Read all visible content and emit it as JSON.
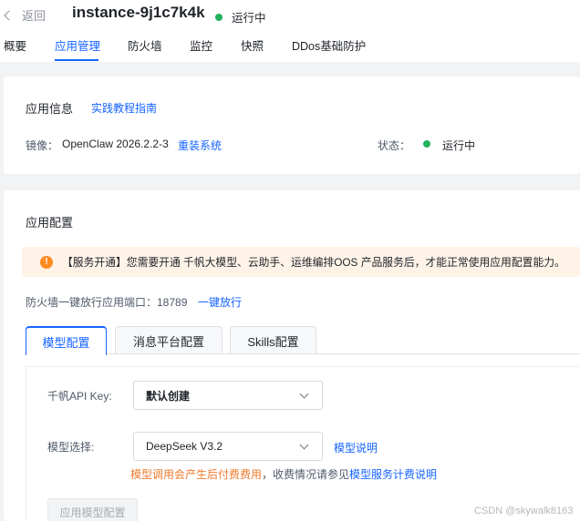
{
  "header": {
    "back_label": "返回",
    "instance_name": "instance-9j1c7k4k",
    "status": "运行中",
    "status_color": "#21b35d"
  },
  "tabs": [
    {
      "label": "概要",
      "active": false
    },
    {
      "label": "应用管理",
      "active": true
    },
    {
      "label": "防火墙",
      "active": false
    },
    {
      "label": "监控",
      "active": false
    },
    {
      "label": "快照",
      "active": false
    },
    {
      "label": "DDos基础防护",
      "active": false
    }
  ],
  "app_info": {
    "title": "应用信息",
    "guide_link": "实践教程指南",
    "image_label": "镜像：",
    "image_value": "OpenClaw 2026.2.2-3",
    "reinstall_link": "重装系统",
    "status_label": "状态：",
    "status_value": "运行中"
  },
  "app_config": {
    "title": "应用配置",
    "alert": "【服务开通】您需要开通 千帆大模型、云助手、运维编排OOS 产品服务后，才能正常使用应用配置能力。",
    "firewall_text": "防火墙一键放行应用端口：18789",
    "firewall_link": "一键放行",
    "subtabs": [
      {
        "label": "模型配置",
        "active": true
      },
      {
        "label": "消息平台配置",
        "active": false
      },
      {
        "label": "Skills配置",
        "active": false
      }
    ],
    "api_key_label": "千帆API Key:",
    "api_key_value": "默认创建",
    "model_label": "模型选择:",
    "model_value": "DeepSeek V3.2",
    "model_link": "模型说明",
    "hint_orange": "模型调用会产生后付费费用",
    "hint_mid": "，收费情况请参见",
    "hint_link": "模型服务计费说明",
    "apply_button": "应用模型配置"
  },
  "watermark": "CSDN @skywalk8163",
  "colors": {
    "accent": "#1664ff",
    "warning": "#ff8a1f",
    "hint": "#ee7a2f"
  }
}
